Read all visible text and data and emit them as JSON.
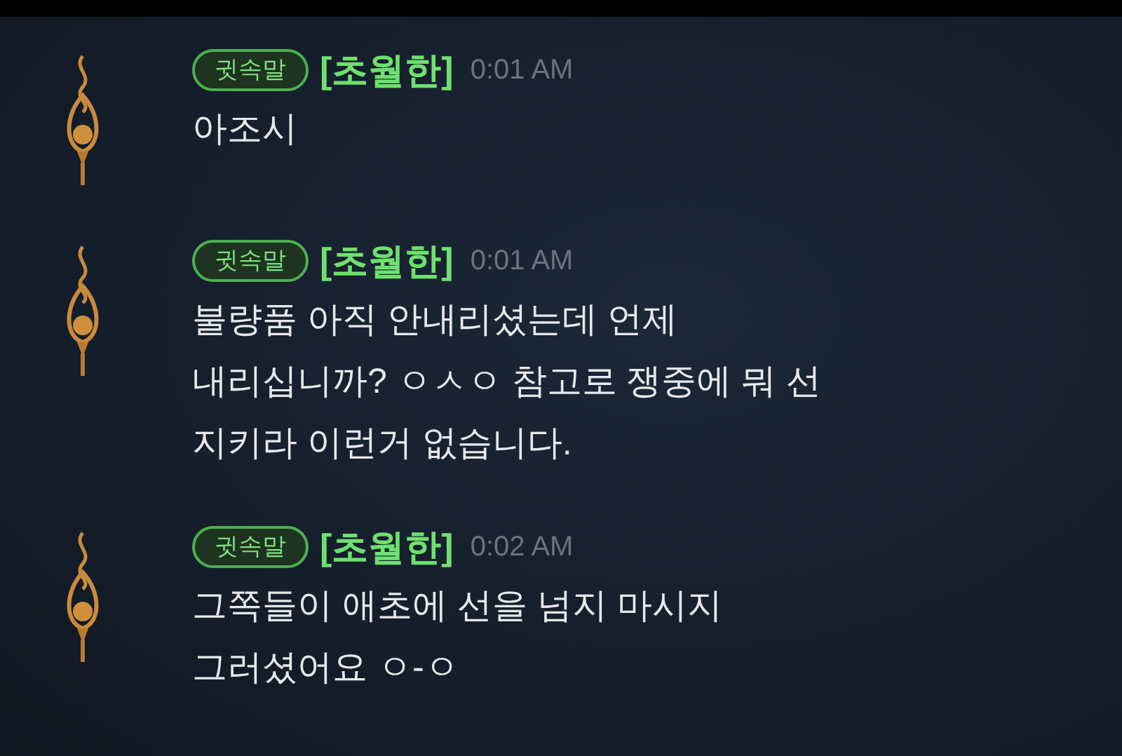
{
  "messages": [
    {
      "channel": "귓속말",
      "sender": "[초월한]",
      "time": "0:01 AM",
      "lines": [
        "아조시"
      ]
    },
    {
      "channel": "귓속말",
      "sender": "[초월한]",
      "time": "0:01 AM",
      "lines": [
        "불량품 아직 안내리셨는데 언제",
        "내리십니까? ㅇㅅㅇ 참고로 쟁중에 뭐 선",
        "지키라 이런거 없습니다."
      ]
    },
    {
      "channel": "귓속말",
      "sender": "[초월한]",
      "time": "0:02 AM",
      "lines": [
        "그쪽들이 애초에 선을 넘지 마시지",
        "그러셨어요 ㅇ-ㅇ"
      ]
    }
  ]
}
